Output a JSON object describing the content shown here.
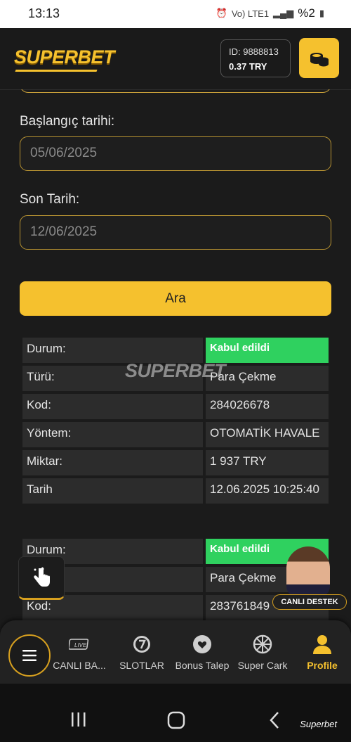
{
  "status_bar": {
    "time": "13:13",
    "battery": "%2",
    "network": "Vo) LTE1"
  },
  "header": {
    "logo_text": "SUPERBET",
    "account_id": "ID: 9888813",
    "balance": "0.37 TRY",
    "coins_icon": "coins-icon"
  },
  "form": {
    "start_label": "Başlangıç tarihi:",
    "start_value": "05/06/2025",
    "end_label": "Son Tarih:",
    "end_value": "12/06/2025",
    "search_label": "Ara"
  },
  "watermark": "SUPERBET",
  "records": [
    {
      "rows": [
        {
          "key": "Durum:",
          "value": "Kabul edildi",
          "status": true
        },
        {
          "key": "Türü:",
          "value": "Para Çekme"
        },
        {
          "key": "Kod:",
          "value": "284026678"
        },
        {
          "key": "Yöntem:",
          "value": "OTOMATİK HAVALE"
        },
        {
          "key": "Miktar:",
          "value": "1 937 TRY"
        },
        {
          "key": "Tarih",
          "value": "12.06.2025 10:25:40"
        }
      ]
    },
    {
      "rows": [
        {
          "key": "Durum:",
          "value": "Kabul edildi",
          "status": true
        },
        {
          "key": "",
          "value": "Para Çekme"
        },
        {
          "key": "Kod:",
          "value": "283761849"
        }
      ]
    }
  ],
  "support": {
    "label": "CANLI DESTEK"
  },
  "bottom_nav": {
    "live_badge": "LIVE",
    "items": [
      {
        "label": "CANLI BA...",
        "icon": "live-tv-icon"
      },
      {
        "label": "SLOTLAR",
        "icon": "slot-seven-icon"
      },
      {
        "label": "Bonus Talep",
        "icon": "heart-icon"
      },
      {
        "label": "Super Cark",
        "icon": "wheel-icon"
      },
      {
        "label": "Profile",
        "icon": "user-icon",
        "active": true
      }
    ]
  },
  "system_bar": {
    "credit": "Superbet"
  },
  "colors": {
    "accent": "#f5c12e",
    "success": "#2fd15f",
    "background": "#1b1b1b"
  }
}
